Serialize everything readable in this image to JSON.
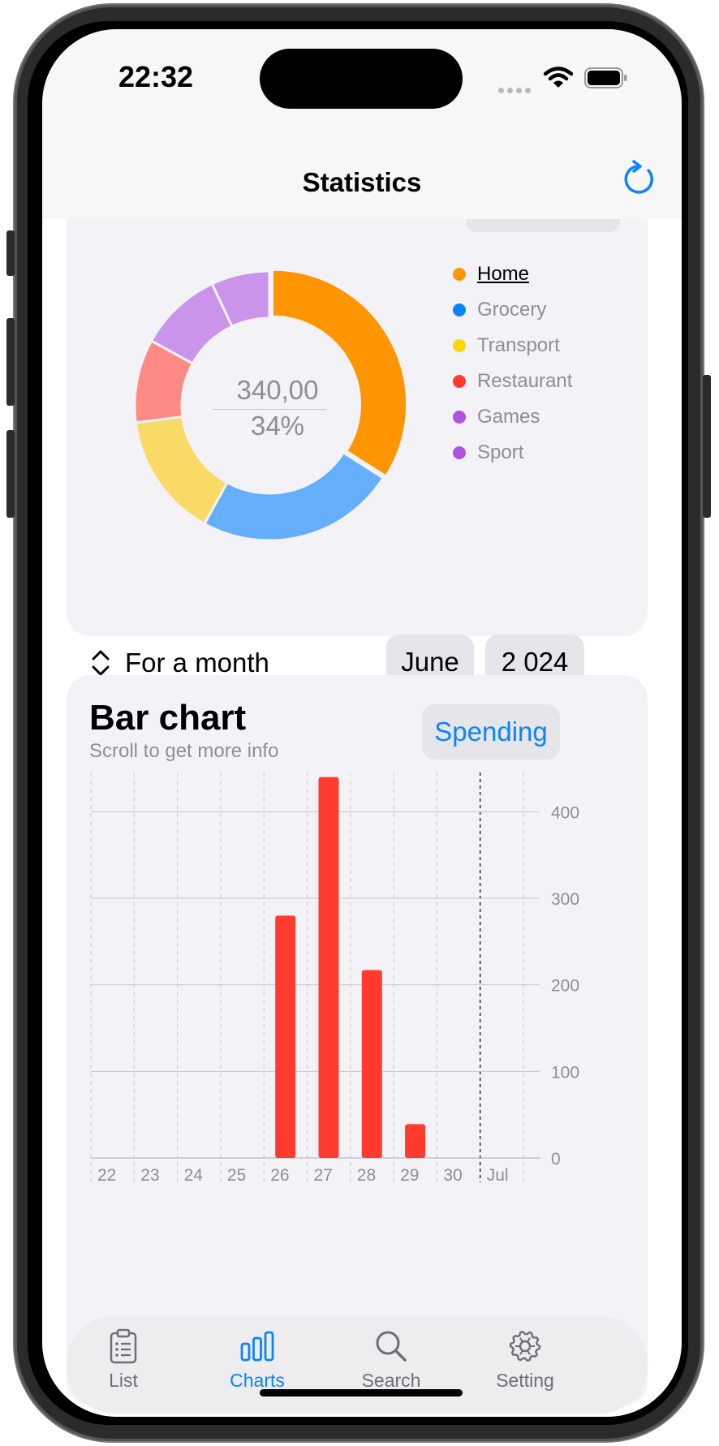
{
  "status_bar": {
    "time": "22:32"
  },
  "nav": {
    "title": "Statistics"
  },
  "pie_card": {
    "center_amount": "340,00",
    "center_percent": "34%",
    "legend": [
      {
        "label": "Home",
        "color": "#ff9500",
        "active": true
      },
      {
        "label": "Grocery",
        "color": "#0a84ff",
        "active": false
      },
      {
        "label": "Transport",
        "color": "#ffd60a",
        "active": false
      },
      {
        "label": "Restaurant",
        "color": "#ff3b30",
        "active": false
      },
      {
        "label": "Games",
        "color": "#af52de",
        "active": false
      },
      {
        "label": "Sport",
        "color": "#af52de",
        "active": false
      }
    ],
    "period_label": "For a month",
    "month": "June",
    "year": "2 024"
  },
  "bar_card": {
    "title": "Bar chart",
    "subtitle": "Scroll to get more info",
    "type_button": "Spending"
  },
  "chart_data": [
    {
      "type": "pie",
      "categories": [
        "Home",
        "Grocery",
        "Transport",
        "Restaurant",
        "Games",
        "Sport"
      ],
      "values": [
        34,
        24,
        15,
        10,
        10,
        7
      ],
      "colors": [
        "#ff9500",
        "#64aefc",
        "#fada66",
        "#fd8a85",
        "#c994e9",
        "#c994e9"
      ],
      "title": ""
    },
    {
      "type": "bar",
      "categories": [
        "22",
        "23",
        "24",
        "25",
        "26",
        "27",
        "28",
        "29",
        "30",
        "Jul"
      ],
      "values": [
        0,
        0,
        0,
        0,
        280,
        440,
        217,
        39,
        0,
        0
      ],
      "yticks": [
        0,
        100,
        200,
        300,
        400
      ],
      "ylim": [
        0,
        450
      ],
      "bar_color": "#ff3b30",
      "title": "",
      "xlabel": "",
      "ylabel": ""
    }
  ],
  "tabbar": {
    "tabs": [
      {
        "label": "List",
        "icon": "clipboard-list-icon",
        "active": false
      },
      {
        "label": "Charts",
        "icon": "bar-chart-icon",
        "active": true
      },
      {
        "label": "Search",
        "icon": "magnifier-icon",
        "active": false
      },
      {
        "label": "Setting",
        "icon": "gear-icon",
        "active": false
      }
    ]
  },
  "colors": {
    "accent": "#0a84ff",
    "card_bg": "#f2f2f7"
  }
}
